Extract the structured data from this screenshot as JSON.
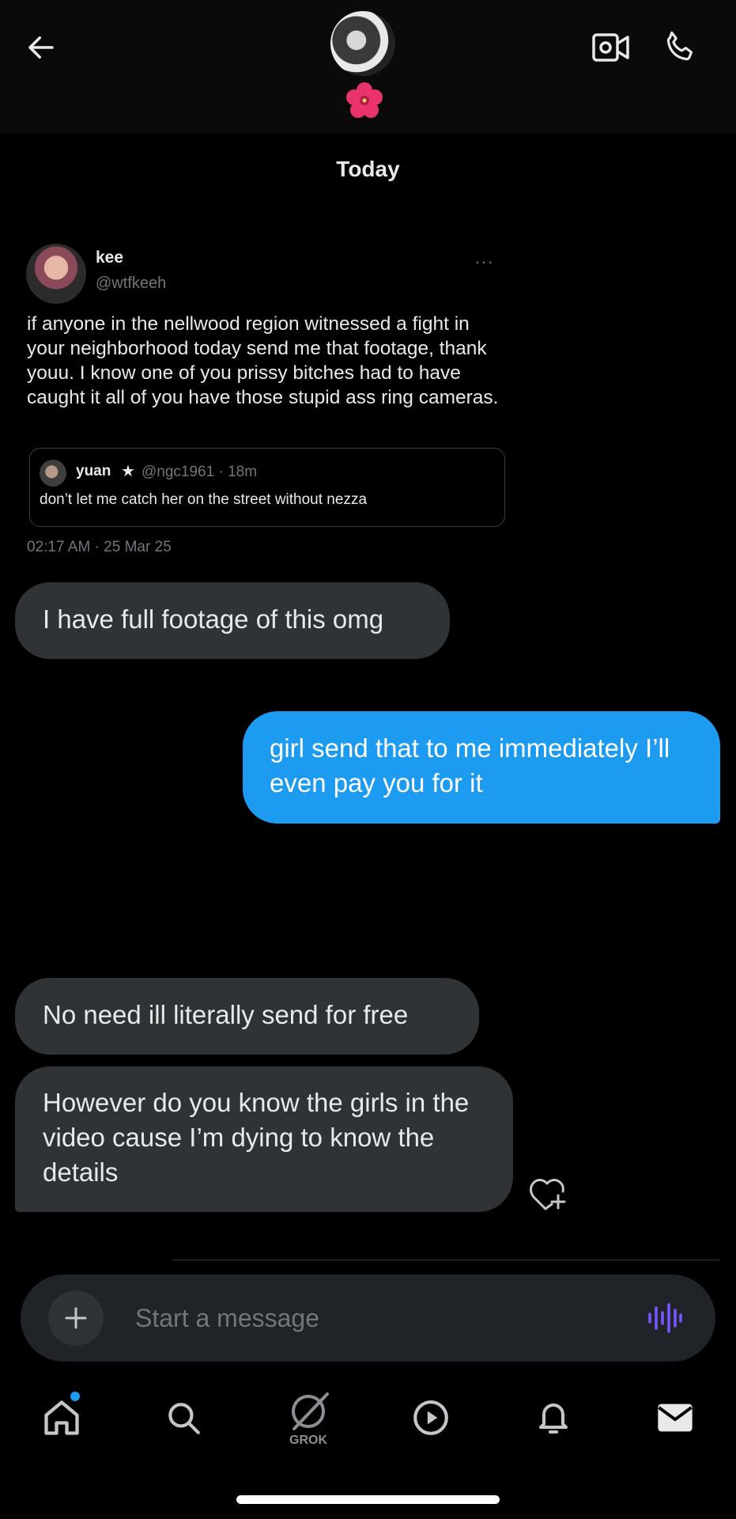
{
  "header": {
    "back_icon": "arrow-left-icon",
    "video_icon": "video-camera-icon",
    "call_icon": "phone-icon",
    "contact_emoji": "🌺"
  },
  "date_divider": "Today",
  "shared_post": {
    "name": "kee",
    "handle": "@wtfkeeh",
    "more": "···",
    "text": "if anyone in the nellwood region witnessed a fight in your neighborhood today send me that footage, thank youu. I know one of you prissy bitches had to have caught it all of you have those stupid ass ring cameras.",
    "quoted": {
      "name": "yuan",
      "badge": "★",
      "handle_time": "@ngc1961 · 18m",
      "text": "don’t let me catch her on the street without nezza"
    },
    "timestamp": "02:17 AM · 25 Mar 25"
  },
  "messages": [
    {
      "direction": "incoming",
      "text": "I have full footage of this omg"
    },
    {
      "direction": "outgoing",
      "text": "girl send that to me immediately I’ll even pay you for it"
    },
    {
      "direction": "incoming",
      "text": "No need ill literally send for free"
    },
    {
      "direction": "incoming",
      "text": "However do you know the girls in the video cause I’m dying to know the details"
    }
  ],
  "composer": {
    "placeholder": "Start a message",
    "add_icon": "plus-icon",
    "voice_icon": "voice-waveform-icon"
  },
  "bottom_nav": {
    "items": [
      {
        "icon": "home-icon",
        "has_badge": true
      },
      {
        "icon": "search-icon"
      },
      {
        "icon": "grok-icon",
        "label": "GROK"
      },
      {
        "icon": "play-icon"
      },
      {
        "icon": "bell-icon"
      },
      {
        "icon": "mail-icon"
      }
    ]
  },
  "colors": {
    "background": "#000000",
    "incoming_bubble": "#2f3336",
    "outgoing_bubble": "#1d9bf0",
    "muted_text": "#71767b",
    "voice_accent": "#7856ff"
  }
}
